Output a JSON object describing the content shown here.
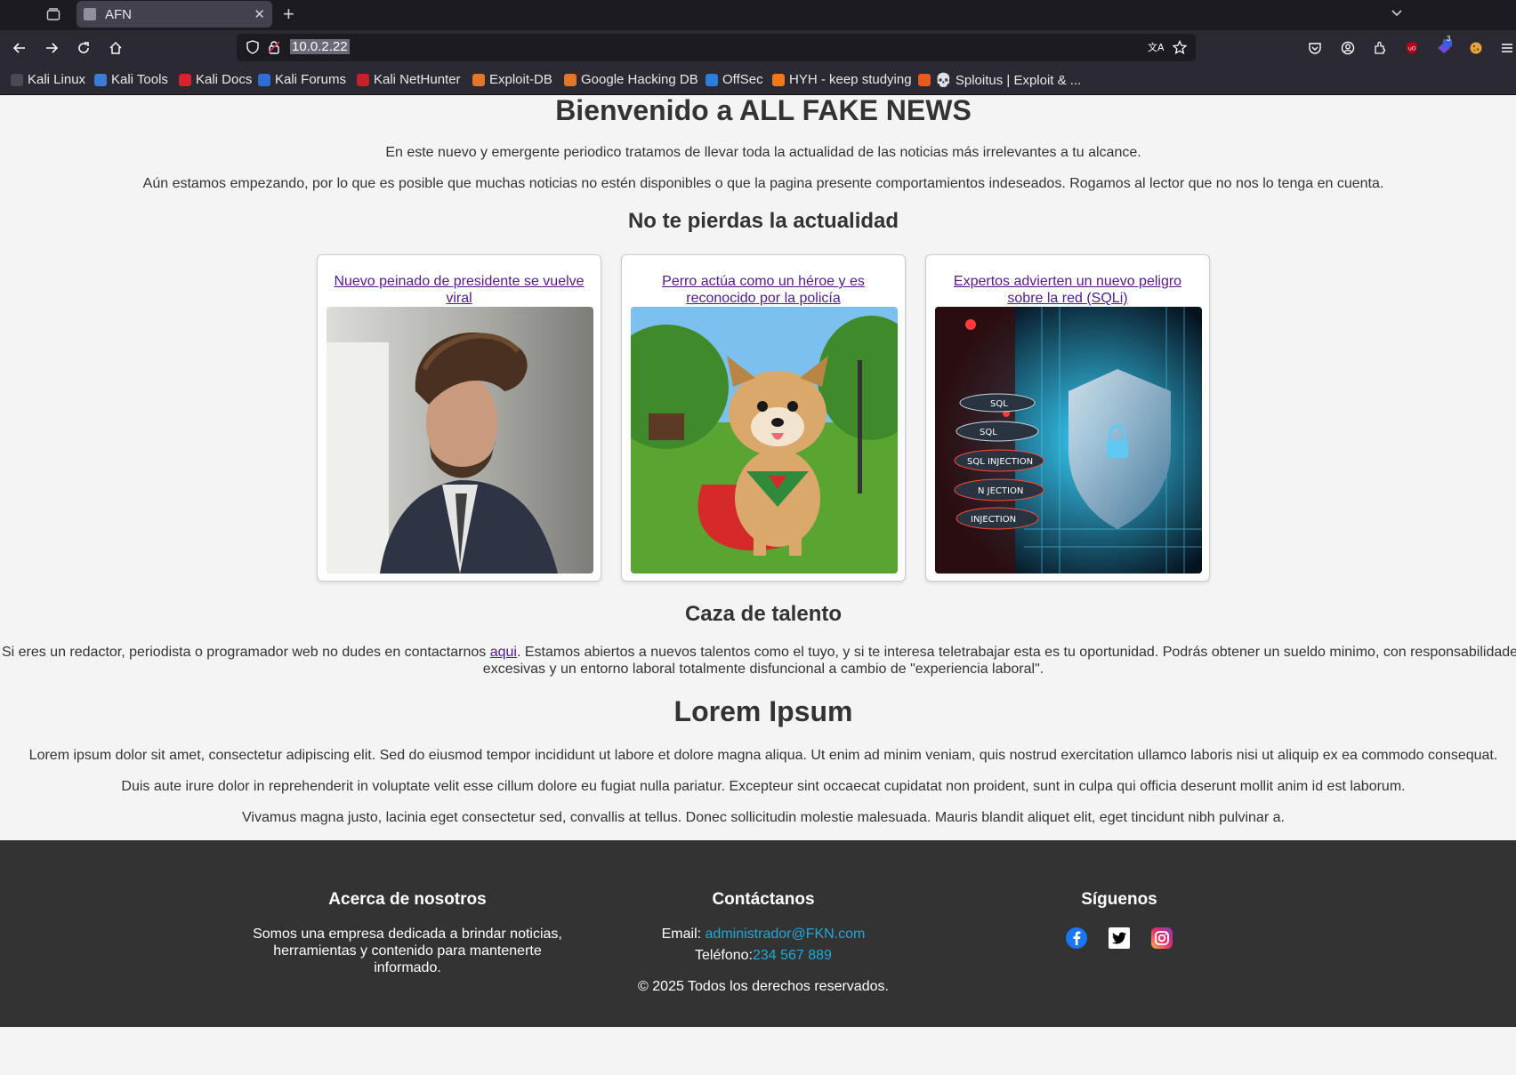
{
  "browser": {
    "tab_title": "AFN",
    "url": "10.0.2.22",
    "bookmarks": [
      {
        "label": "Kali Linux",
        "icon": "kali-dragon-icon"
      },
      {
        "label": "Kali Tools",
        "icon": "kali-tools-icon"
      },
      {
        "label": "Kali Docs",
        "icon": "kali-docs-icon"
      },
      {
        "label": "Kali Forums",
        "icon": "kali-forums-icon"
      },
      {
        "label": "Kali NetHunter",
        "icon": "nethunter-icon"
      },
      {
        "label": "Exploit-DB",
        "icon": "exploit-db-icon"
      },
      {
        "label": "Google Hacking DB",
        "icon": "ghdb-icon"
      },
      {
        "label": "OffSec",
        "icon": "offsec-icon"
      },
      {
        "label": "HYH - keep studying",
        "icon": "fire-icon"
      },
      {
        "label": "💀 Sploitus | Exploit & ...",
        "icon": "sploitus-icon"
      }
    ],
    "extension_badge": "3"
  },
  "page": {
    "title": "Bienvenido a ALL FAKE NEWS",
    "intro_1": "En este nuevo y emergente periodico tratamos de llevar toda la actualidad de las noticias más irrelevantes a tu alcance.",
    "intro_2": "Aún estamos empezando, por lo que es posible que muchas noticias no estén disponibles o que la pagina presente comportamientos indeseados. Rogamos al lector que no nos lo tenga en cuenta.",
    "news_heading": "No te pierdas la actualidad",
    "news": [
      {
        "title": "Nuevo peinado de presidente se vuelve viral"
      },
      {
        "title": "Perro actúa como un héroe y es reconocido por la policía"
      },
      {
        "title": "Expertos advierten un nuevo peligro sobre la red (SQLi)"
      }
    ],
    "sqli_image_labels": [
      "SQL",
      "SQL",
      "SQL INJECTION",
      "N JECTION",
      "INJECTION"
    ],
    "talent_heading": "Caza de talento",
    "talent_before": "Si eres un redactor, periodista o programador web no dudes en contactarnos ",
    "talent_link": "aqui",
    "talent_after_1": ". Estamos abiertos a nuevos talentos como el tuyo, y si te interesa teletrabajar esta es tu oportunidad. Podrás obtener un sueldo minimo, con responsabilidades",
    "talent_after_2": "excesivas y un entorno laboral totalmente disfuncional a cambio de \"experiencia laboral\".",
    "lorem_heading": "Lorem Ipsum",
    "lorem_1": "Lorem ipsum dolor sit amet, consectetur adipiscing elit. Sed do eiusmod tempor incididunt ut labore et dolore magna aliqua. Ut enim ad minim veniam, quis nostrud exercitation ullamco laboris nisi ut aliquip ex ea commodo consequat.",
    "lorem_2": "Duis aute irure dolor in reprehenderit in voluptate velit esse cillum dolore eu fugiat nulla pariatur. Excepteur sint occaecat cupidatat non proident, sunt in culpa qui officia deserunt mollit anim id est laborum.",
    "lorem_3": "Vivamus magna justo, lacinia eget consectetur sed, convallis at tellus. Donec sollicitudin molestie malesuada. Mauris blandit aliquet elit, eget tincidunt nibh pulvinar a."
  },
  "footer": {
    "about_heading": "Acerca de nosotros",
    "about_text": "Somos una empresa dedicada a brindar noticias, herramientas y contenido para mantenerte informado.",
    "contact_heading": "Contáctanos",
    "email_label": "Email: ",
    "email_value": "administrador@FKN.com",
    "phone_label": "Teléfono: ",
    "phone_value": "234 567 889",
    "follow_heading": "Síguenos",
    "social_icons": [
      "facebook-icon",
      "twitter-icon",
      "instagram-icon"
    ],
    "copyright": "© 2025 Todos los derechos reservados."
  },
  "colors": {
    "link": "#551a8b",
    "footer_bg": "#333333",
    "footer_link": "#1ea9d6",
    "page_bg": "#f4f4f4"
  }
}
